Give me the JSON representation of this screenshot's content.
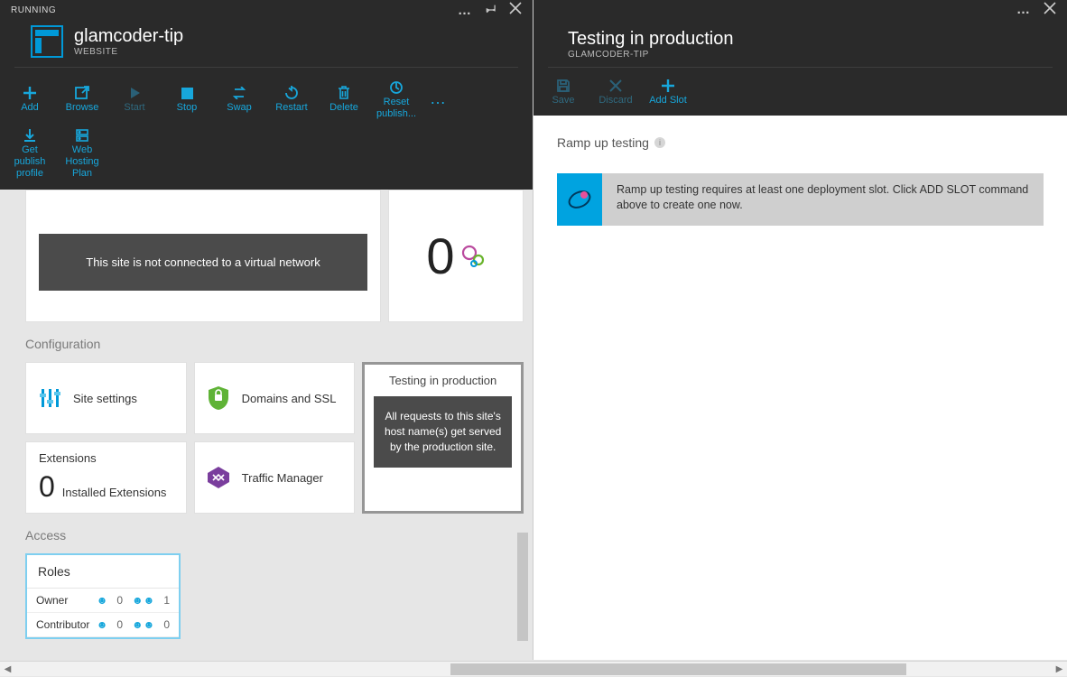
{
  "leftBlade": {
    "status": "RUNNING",
    "title": "glamcoder-tip",
    "subtitle": "WEBSITE",
    "toolbar": {
      "add": "Add",
      "browse": "Browse",
      "start": "Start",
      "stop": "Stop",
      "swap": "Swap",
      "restart": "Restart",
      "delete": "Delete",
      "resetPublish": "Reset publish...",
      "getPublish": "Get publish profile",
      "webHosting": "Web Hosting Plan"
    },
    "vnetMessage": "This site is not connected to a virtual network",
    "webjobsCount": "0",
    "configuration": {
      "label": "Configuration",
      "siteSettings": "Site settings",
      "domainsSsl": "Domains and SSL",
      "trafficManager": "Traffic Manager",
      "tip": {
        "title": "Testing in production",
        "body": "All requests to this site's host name(s) get served by the production site."
      }
    },
    "extensions": {
      "label": "Extensions",
      "count": "0",
      "text": "Installed Extensions"
    },
    "access": {
      "label": "Access",
      "rolesHeader": "Roles",
      "rows": [
        {
          "name": "Owner",
          "users": "0",
          "groups": "1"
        },
        {
          "name": "Contributor",
          "users": "0",
          "groups": "0"
        }
      ]
    }
  },
  "rightBlade": {
    "title": "Testing in production",
    "subtitle": "GLAMCODER-TIP",
    "toolbar": {
      "save": "Save",
      "discard": "Discard",
      "addSlot": "Add Slot"
    },
    "rampLabel": "Ramp up testing",
    "rampMessage": "Ramp up testing requires at least one deployment slot. Click ADD SLOT command above to create one now."
  }
}
